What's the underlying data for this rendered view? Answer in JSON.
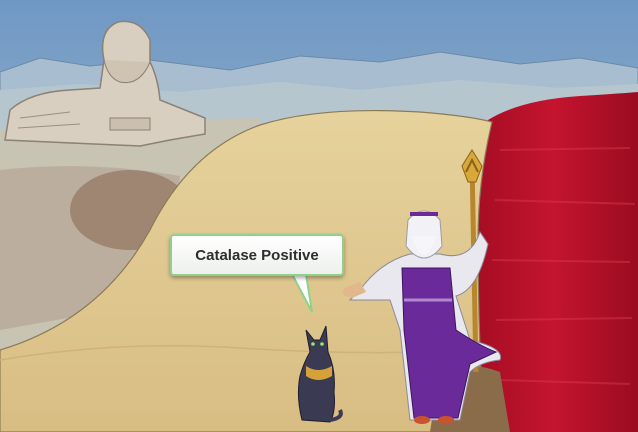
{
  "scene": {
    "speech_bubble": {
      "text": "Catalase Positive"
    },
    "colors": {
      "sky": "#8fb0cf",
      "sand": "#dcc28a",
      "red_sea": "#b8102a",
      "bubble_border": "#8fd18a",
      "robe_purple": "#6a2a9a",
      "cat": "#3a3a52"
    },
    "characters": [
      "sphinx",
      "black-cat",
      "moses-figure-with-staff"
    ]
  }
}
